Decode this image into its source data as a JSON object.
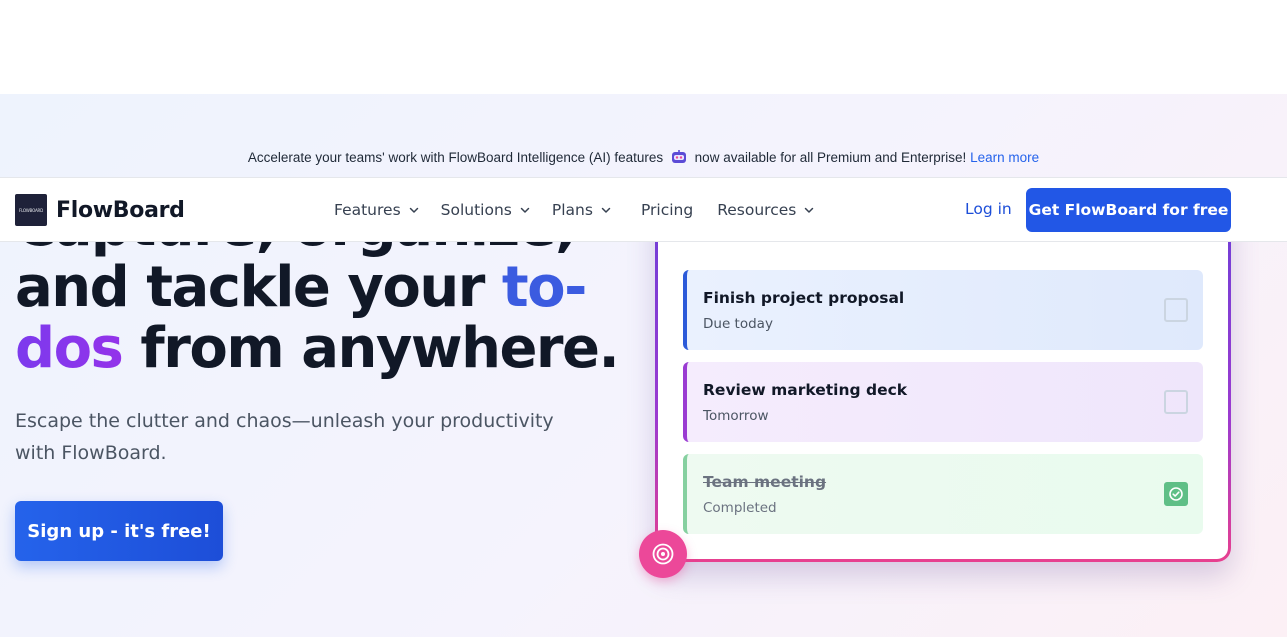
{
  "banner": {
    "text_before": "Accelerate your teams' work with FlowBoard Intelligence (AI) features",
    "text_after": "now available for all Premium and Enterprise!",
    "link_label": "Learn more",
    "icon": "robot-icon"
  },
  "nav": {
    "logo_mark_text": "FLOWBOARD",
    "brand": "FlowBoard",
    "items": [
      {
        "label": "Features",
        "dropdown": true
      },
      {
        "label": "Solutions",
        "dropdown": true
      },
      {
        "label": "Plans",
        "dropdown": true
      },
      {
        "label": "Pricing",
        "dropdown": false
      },
      {
        "label": "Resources",
        "dropdown": true
      }
    ],
    "login_label": "Log in",
    "cta_label": "Get FlowBoard for free"
  },
  "hero": {
    "headline_line1": "Capture, organize,",
    "headline_line2_plain": "and tackle your ",
    "headline_line2_accent": "to-",
    "headline_line3_accent": "dos",
    "headline_line3_plain": " from anywhere.",
    "subtext": "Escape the clutter and chaos—unleash your productivity with FlowBoard.",
    "cta_label": "Sign up - it's free!"
  },
  "tasks": [
    {
      "title": "Finish project proposal",
      "due": "Due today",
      "completed": false
    },
    {
      "title": "Review marketing deck",
      "due": "Tomorrow",
      "completed": false
    },
    {
      "title": "Team meeting",
      "due": "Completed",
      "completed": true
    }
  ],
  "colors": {
    "primary": "#2257e6",
    "accent_purple": "#9333ea",
    "accent_pink": "#ec4899",
    "success": "#5fbf86"
  }
}
